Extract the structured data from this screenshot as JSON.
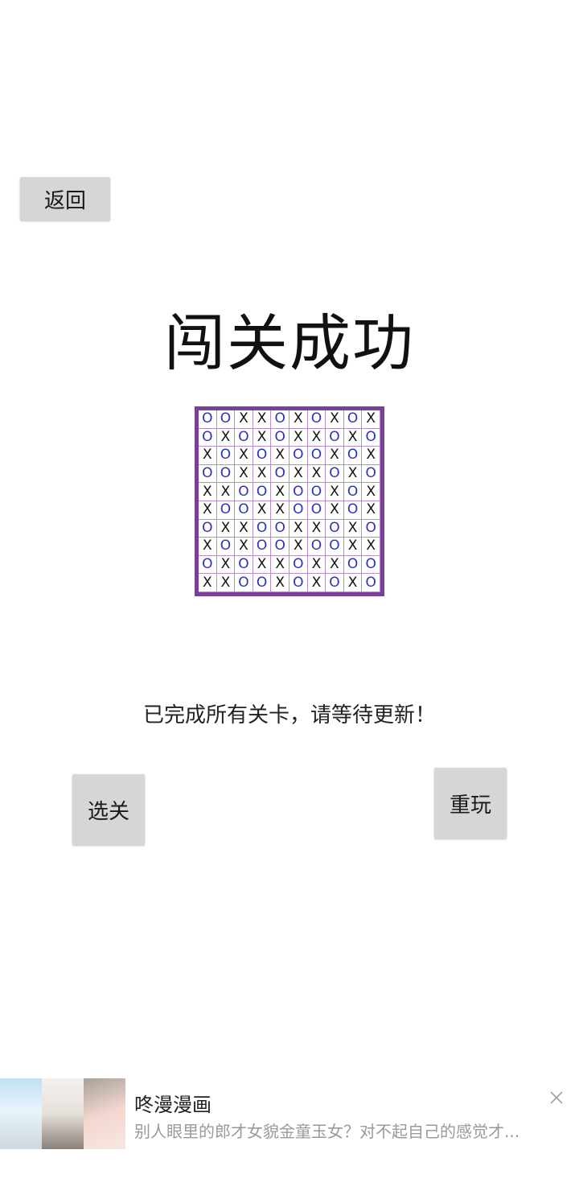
{
  "buttons": {
    "back_label": "返回",
    "select_label": "选关",
    "replay_label": "重玩"
  },
  "title": "闯关成功",
  "board": {
    "rows": [
      "OOXXOXOXOX",
      "OXOXOXXOXO",
      "XOXOXOOXOX",
      "OOXXOXXOXO",
      "XXOOXOOXOX",
      "XOOXXOOXOX",
      "OXXOOXXOXO",
      "XOXOOXOOXX",
      "OXOXXOXXOO",
      "XXOOXOXOXO"
    ],
    "border_color": "#7b3f98",
    "o_color": "#2a33b8"
  },
  "message": "已完成所有关卡，请等待更新！",
  "ad": {
    "title": "咚漫漫画",
    "description": "别人眼里的郎才女貌金童玉女？对不起自己的感觉才...",
    "close_icon": "close-icon"
  }
}
